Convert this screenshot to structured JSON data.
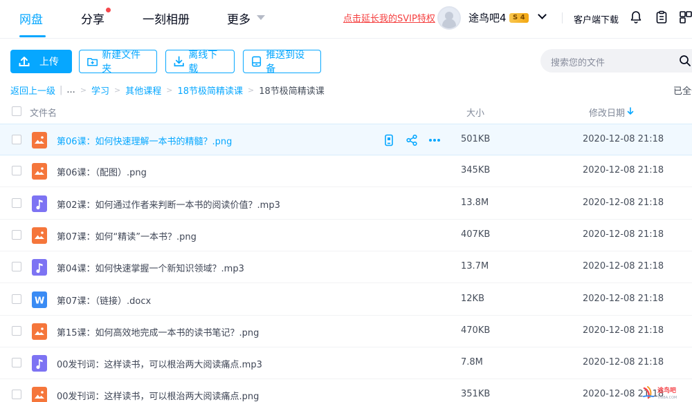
{
  "nav": {
    "tabs": [
      {
        "label": "网盘"
      },
      {
        "label": "分享"
      },
      {
        "label": "一刻相册"
      },
      {
        "label": "更多"
      }
    ],
    "svip_link": "点击延长我的SVIP特权",
    "username": "途鸟吧4",
    "level": "4",
    "client_download": "客户端下载"
  },
  "toolbar": {
    "upload": "上传",
    "new_folder": "新建文件夹",
    "offline_download": "离线下载",
    "push_device": "推送到设备",
    "search_placeholder": "搜索您的文件"
  },
  "breadcrumb": {
    "back": "返回上一级",
    "ellipsis": "...",
    "items": [
      "学习",
      "其他课程",
      "18节极简精读课"
    ],
    "current": "18节极简精读课",
    "loaded": "已全部加载"
  },
  "table": {
    "headers": {
      "name": "文件名",
      "size": "大小",
      "modified": "修改日期"
    },
    "rows": [
      {
        "name": "第06课：如何快速理解一本书的精髓？.png",
        "size": "501KB",
        "date": "2020-12-08 21:18",
        "type": "png"
      },
      {
        "name": "第06课：（配图）.png",
        "size": "345KB",
        "date": "2020-12-08 21:18",
        "type": "png"
      },
      {
        "name": "第02课：如何通过作者来判断一本书的阅读价值？.mp3",
        "size": "13.8M",
        "date": "2020-12-08 21:18",
        "type": "mp3"
      },
      {
        "name": "第07课：如何“精读”一本书？.png",
        "size": "407KB",
        "date": "2020-12-08 21:18",
        "type": "png"
      },
      {
        "name": "第04课：如何快速掌握一个新知识领域？.mp3",
        "size": "13.7M",
        "date": "2020-12-08 21:18",
        "type": "mp3"
      },
      {
        "name": "第07课：（链接）.docx",
        "size": "12KB",
        "date": "2020-12-08 21:18",
        "type": "docx"
      },
      {
        "name": "第15课：如何高效地完成一本书的读书笔记？.png",
        "size": "470KB",
        "date": "2020-12-08 21:18",
        "type": "png"
      },
      {
        "name": "00发刊词：这样读书，可以根治两大阅读痛点.mp3",
        "size": "7.8M",
        "date": "2020-12-08 21:18",
        "type": "mp3"
      },
      {
        "name": "00发刊词：这样读书，可以根治两大阅读痛点.png",
        "size": "351KB",
        "date": "2020-12-08 21:18",
        "type": "png"
      }
    ]
  },
  "watermark": {
    "brand": "途鸟吧",
    "site": "TNIBA.COM"
  },
  "colors": {
    "accent": "#06a7ff",
    "svip": "#f53f3f",
    "png": "#f5763b",
    "mp3": "#7d73f3",
    "docx": "#3a8bf4"
  }
}
